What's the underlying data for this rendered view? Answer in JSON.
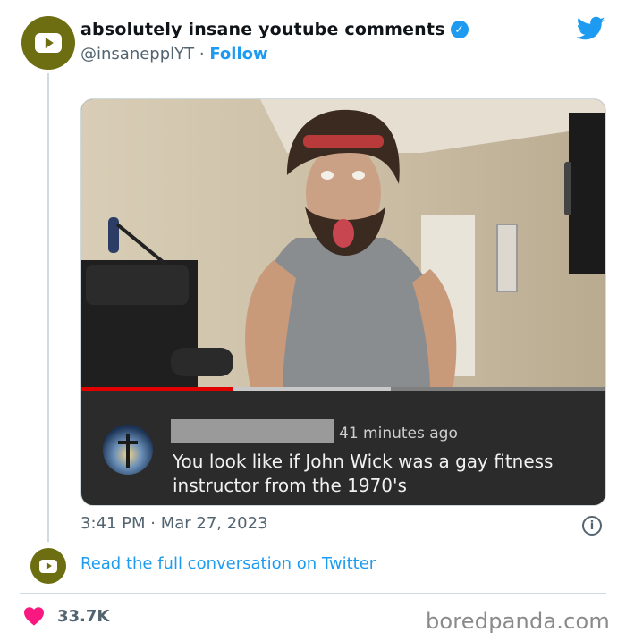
{
  "tweet": {
    "display_name": "absolutely insane youtube comments",
    "handle": "@insanepplYT",
    "separator": "·",
    "follow_label": "Follow",
    "timestamp": "3:41 PM · Mar 27, 2023",
    "read_conversation": "Read the full conversation on Twitter",
    "likes": "33.7K"
  },
  "embedded_video": {
    "progress": 0.29,
    "buffered": 0.59,
    "comment": {
      "time_ago": "41 minutes ago",
      "text": "You look like if John Wick was a gay fitness instructor from the 1970's"
    }
  },
  "icons": {
    "avatar": "youtube-play-icon",
    "verified": "verified-badge-icon",
    "brand": "twitter-bird-icon",
    "info": "info-icon",
    "like": "heart-icon"
  },
  "colors": {
    "avatar_bg": "#6d6d12",
    "link": "#1d9bf0",
    "heart": "#f91880",
    "secondary_text": "#536471",
    "progress_red": "#e10000"
  },
  "watermark": "boredpanda.com"
}
